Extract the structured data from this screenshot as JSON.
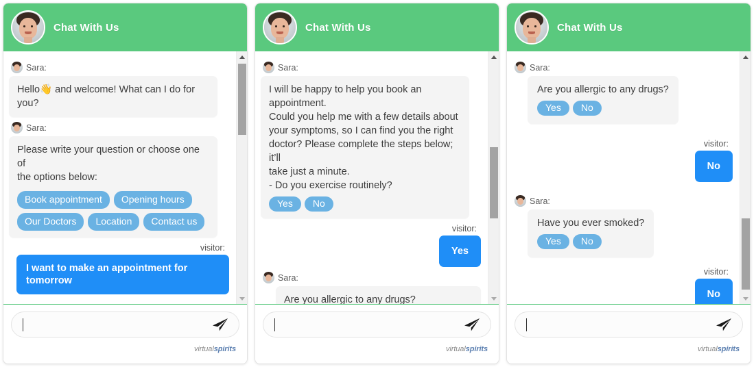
{
  "widget": {
    "header_title": "Chat With Us",
    "agent_name": "Sara:",
    "visitor_label": "visitor:",
    "brand_prefix": "virtual",
    "brand_suffix": "spirits",
    "input_placeholder": "",
    "input_value": "",
    "send_icon": "paper-plane-icon",
    "avatar_icon": "agent-avatar",
    "colors": {
      "header_green": "#5ac97e",
      "bot_bubble": "#f4f4f4",
      "chip_blue": "#6ab2e3",
      "visitor_blue": "#1f8ef7",
      "scroll_thumb": "#a3a3a3",
      "scroll_track": "#f1f1f1"
    }
  },
  "panels": [
    {
      "id": "panel-1",
      "scroll_thumb": {
        "top_pct": 2,
        "height_pct": 28
      },
      "messages": [
        {
          "type": "bot",
          "name": "Sara:",
          "indent": false,
          "lines": [
            "Hello👋 and welcome! What can I do for you?"
          ],
          "chips": []
        },
        {
          "type": "bot",
          "name": "Sara:",
          "indent": false,
          "lines": [
            "Please write your question or choose one of",
            "the options below:"
          ],
          "chips": [
            "Book appointment",
            "Opening hours",
            "Our Doctors",
            "Location",
            "Contact us"
          ]
        },
        {
          "type": "visitor",
          "label": "visitor:",
          "text": "I want to make an appointment for tomorrow"
        }
      ]
    },
    {
      "id": "panel-2",
      "scroll_thumb": {
        "top_pct": 34,
        "height_pct": 28
      },
      "messages": [
        {
          "type": "bot",
          "name": "Sara:",
          "indent": false,
          "lines": [
            "I will be happy to help you book an",
            "appointment.",
            "Could you help me with a few details about",
            "your symptoms, so I can find you the right",
            "doctor? Please complete the steps below; it’ll",
            "take just a minute.",
            "- Do you exercise routinely?"
          ],
          "chips": [
            "Yes",
            "No"
          ]
        },
        {
          "type": "visitor",
          "label": "visitor:",
          "text": "Yes"
        },
        {
          "type": "bot",
          "name": "Sara:",
          "indent": true,
          "lines": [
            "Are you allergic to any drugs?"
          ],
          "chips": []
        }
      ]
    },
    {
      "id": "panel-3",
      "scroll_thumb": {
        "top_pct": 66,
        "height_pct": 28
      },
      "messages": [
        {
          "type": "bot",
          "name": "Sara:",
          "indent": true,
          "lines": [
            "Are you allergic to any drugs?"
          ],
          "chips": [
            "Yes",
            "No"
          ]
        },
        {
          "type": "visitor",
          "label": "visitor:",
          "text": "No"
        },
        {
          "type": "bot",
          "name": "Sara:",
          "indent": true,
          "lines": [
            "Have you ever smoked?"
          ],
          "chips": [
            "Yes",
            "No"
          ]
        },
        {
          "type": "visitor",
          "label": "visitor:",
          "text": "No"
        }
      ]
    }
  ]
}
